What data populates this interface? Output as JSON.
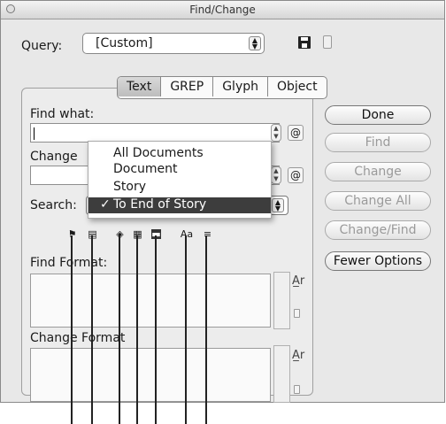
{
  "window": {
    "title": "Find/Change"
  },
  "query": {
    "label": "Query:",
    "value": "[Custom]",
    "save_icon": "floppy-disk-icon",
    "delete_icon": "trash-icon"
  },
  "tabs": [
    {
      "label": "Text",
      "selected": true
    },
    {
      "label": "GREP",
      "selected": false
    },
    {
      "label": "Glyph",
      "selected": false
    },
    {
      "label": "Object",
      "selected": false
    }
  ],
  "find_what": {
    "label": "Find what:",
    "value": ""
  },
  "change_to": {
    "label": "Change",
    "value": ""
  },
  "search": {
    "label": "Search:",
    "selected": "To End of Story"
  },
  "search_menu": {
    "options": [
      "All Documents",
      "Document",
      "Story",
      "To End of Story"
    ],
    "checked_index": 3,
    "check_mark": "✓"
  },
  "options_icons": [
    "include-locked-layers-icon",
    "include-locked-stories-icon",
    "include-hidden-layers-icon",
    "include-master-pages-icon",
    "include-footnotes-icon",
    "case-sensitive-icon",
    "whole-word-icon"
  ],
  "options_glyphs": {
    "case_sensitive": "Aa"
  },
  "find_format": {
    "label": "Find Format:"
  },
  "change_format": {
    "label": "Change Format"
  },
  "buttons": {
    "done": "Done",
    "find": "Find",
    "change": "Change",
    "change_all": "Change All",
    "change_find": "Change/Find",
    "fewer_options": "Fewer Options"
  },
  "colors": {
    "window_bg": "#e8e8e8",
    "menu_highlight": "#3d3d3d"
  }
}
